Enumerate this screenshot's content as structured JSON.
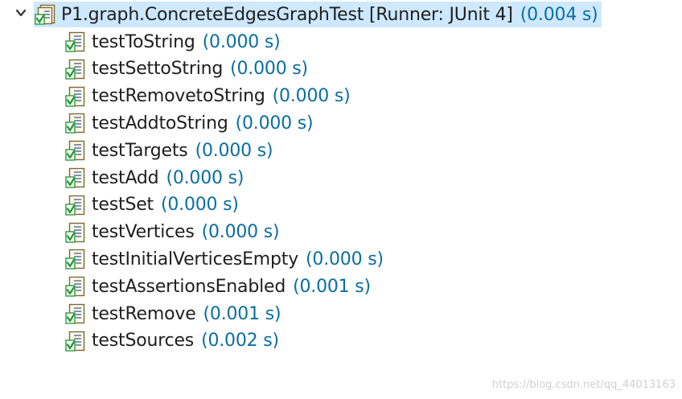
{
  "root": {
    "label": "P1.graph.ConcreteEdgesGraphTest [Runner: JUnit 4]",
    "time": "(0.004 s)",
    "expanded": true,
    "icon": "test-suite-passed-icon"
  },
  "tests": [
    {
      "label": "testToString",
      "time": "(0.000 s)"
    },
    {
      "label": "testSettoString",
      "time": "(0.000 s)"
    },
    {
      "label": "testRemovetoString",
      "time": "(0.000 s)"
    },
    {
      "label": "testAddtoString",
      "time": "(0.000 s)"
    },
    {
      "label": "testTargets",
      "time": "(0.000 s)"
    },
    {
      "label": "testAdd",
      "time": "(0.000 s)"
    },
    {
      "label": "testSet",
      "time": "(0.000 s)"
    },
    {
      "label": "testVertices",
      "time": "(0.000 s)"
    },
    {
      "label": "testInitialVerticesEmpty",
      "time": "(0.000 s)"
    },
    {
      "label": "testAssertionsEnabled",
      "time": "(0.001 s)"
    },
    {
      "label": "testRemove",
      "time": "(0.001 s)"
    },
    {
      "label": "testSources",
      "time": "(0.002 s)"
    }
  ],
  "test_icon": "test-passed-icon",
  "colors": {
    "selection": "#cde8ff",
    "time_text": "#0a6ea0",
    "label_text": "#1e1e1e",
    "check_green": "#2a9a3a"
  },
  "watermark": "https://blog.csdn.net/qq_44013163"
}
